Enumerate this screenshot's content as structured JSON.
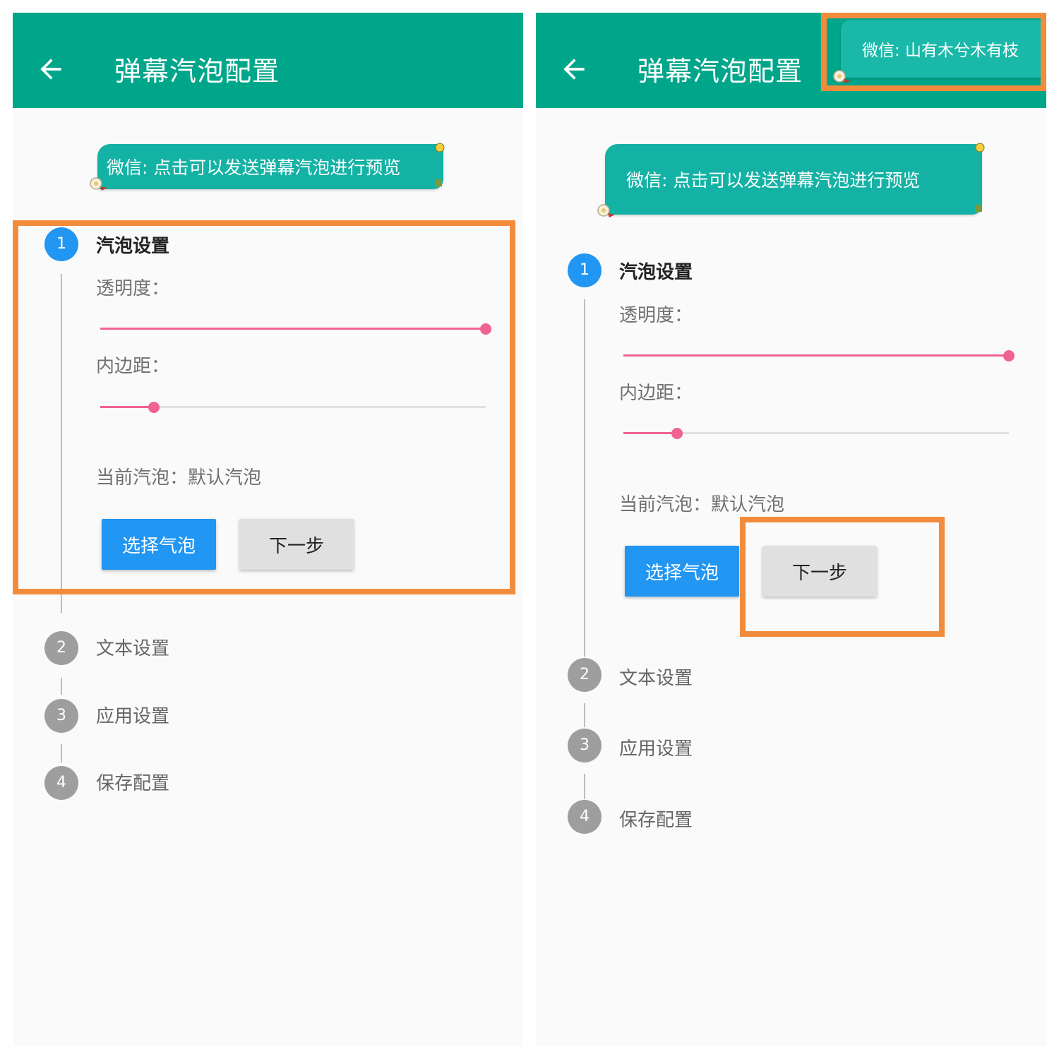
{
  "appbar": {
    "title": "弹幕汽泡配置"
  },
  "preview_bubble": {
    "text": "微信: 点击可以发送弹幕汽泡进行预览"
  },
  "danmaku_bubble": {
    "text": "微信: 山有木兮木有枝"
  },
  "steps": [
    {
      "number": "1",
      "label": "汽泡设置",
      "active": true
    },
    {
      "number": "2",
      "label": "文本设置",
      "active": false
    },
    {
      "number": "3",
      "label": "应用设置",
      "active": false
    },
    {
      "number": "4",
      "label": "保存配置",
      "active": false
    }
  ],
  "bubble_settings": {
    "opacity_label": "透明度：",
    "opacity_value_fraction": 1.0,
    "padding_label": "内边距：",
    "padding_value_fraction": 0.14,
    "current_bubble_label": "当前汽泡：",
    "current_bubble_value": "默认汽泡",
    "select_button": "选择气泡",
    "next_button": "下一步"
  },
  "colors": {
    "appbar": "#00a68a",
    "bubble": "#14b2a4",
    "step_active": "#2196f3",
    "step_inactive": "#9e9e9e",
    "slider": "#f06292",
    "highlight": "#f28c3c"
  },
  "icons": {
    "back": "arrow-left-icon",
    "bubble_decoration": "flower-sticker-icon"
  }
}
